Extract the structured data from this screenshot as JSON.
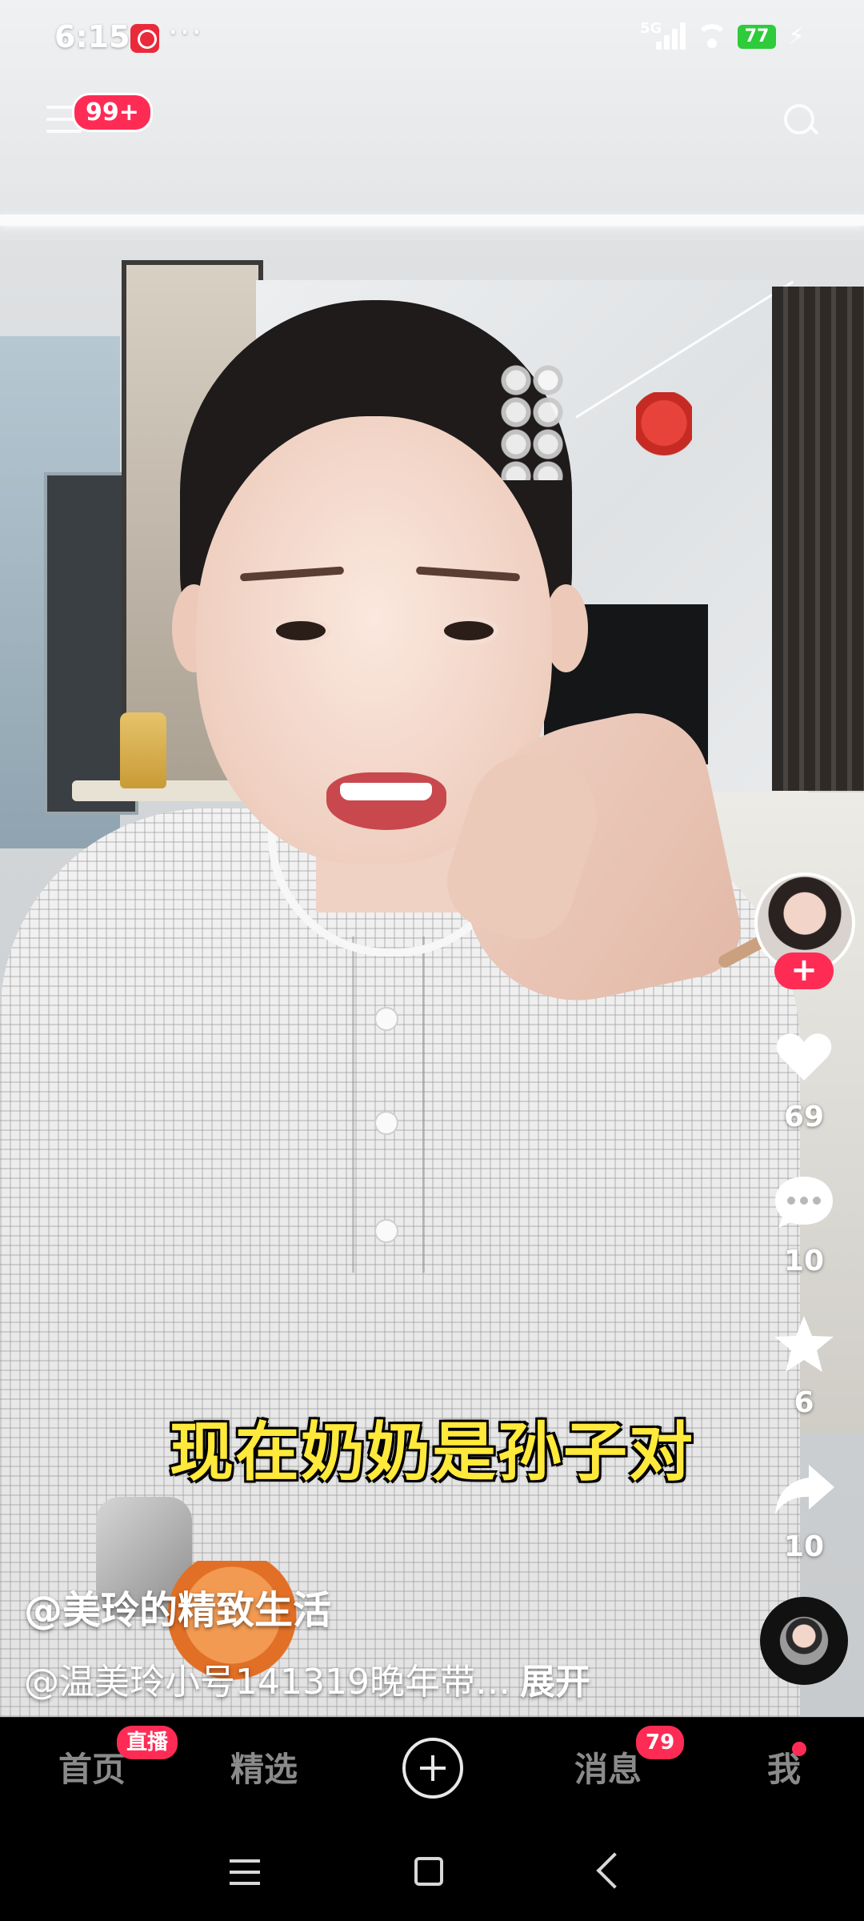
{
  "status_bar": {
    "time": "6:15",
    "more": "···",
    "network": "5G",
    "battery": "77"
  },
  "top": {
    "notification_badge": "99+"
  },
  "video": {
    "subtitle": "现在奶奶是孙子对"
  },
  "right_rail": {
    "follow_label": "+",
    "likes": "69",
    "comments": "10",
    "favorites": "6",
    "shares": "10"
  },
  "post": {
    "author": "@美玲的精致生活",
    "description": "@温美玲小号141319晚年带…",
    "expand_label": "展开"
  },
  "bottom_nav": {
    "home": "首页",
    "home_badge": "直播",
    "featured": "精选",
    "messages": "消息",
    "messages_badge": "79",
    "me": "我"
  },
  "colors": {
    "accent": "#fe2c55",
    "subtitle": "#ffe93b",
    "battery": "#2ecb3a"
  },
  "icons": [
    "menu-icon",
    "search-icon",
    "heart-icon",
    "comment-icon",
    "star-icon",
    "share-icon",
    "create-icon",
    "music-disc",
    "sys-menu-icon",
    "sys-home-icon",
    "sys-back-icon"
  ]
}
